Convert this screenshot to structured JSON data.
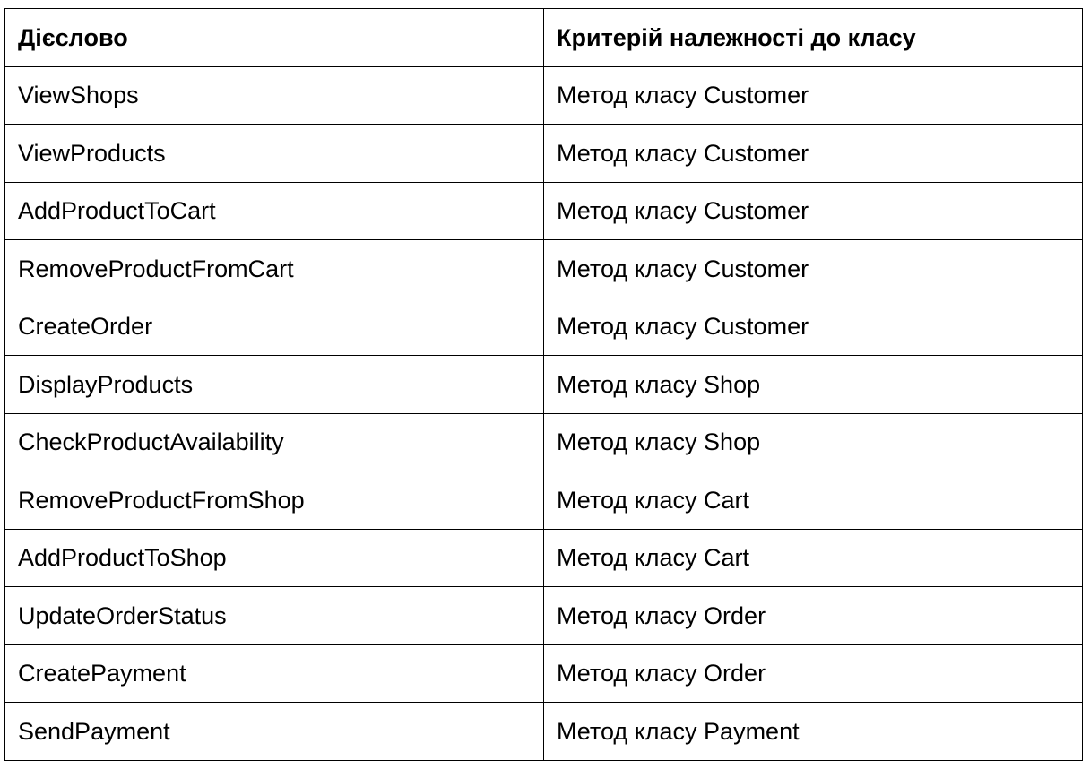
{
  "table": {
    "headers": [
      "Дієслово",
      "Критерій належності до класу"
    ],
    "rows": [
      [
        "ViewShops",
        "Метод класу Customer"
      ],
      [
        "ViewProducts",
        "Метод класу Customer"
      ],
      [
        "AddProductToCart",
        "Метод класу Customer"
      ],
      [
        "RemoveProductFromCart",
        "Метод класу Customer"
      ],
      [
        "CreateOrder",
        "Метод класу Customer"
      ],
      [
        "DisplayProducts",
        "Метод класу Shop"
      ],
      [
        "CheckProductAvailability",
        "Метод класу Shop"
      ],
      [
        "RemoveProductFromShop",
        "Метод класу Cart"
      ],
      [
        "AddProductToShop",
        "Метод класу Cart"
      ],
      [
        "UpdateOrderStatus",
        "Метод класу Order"
      ],
      [
        "CreatePayment",
        "Метод класу Order"
      ],
      [
        "SendPayment",
        "Метод класу Payment"
      ]
    ]
  }
}
